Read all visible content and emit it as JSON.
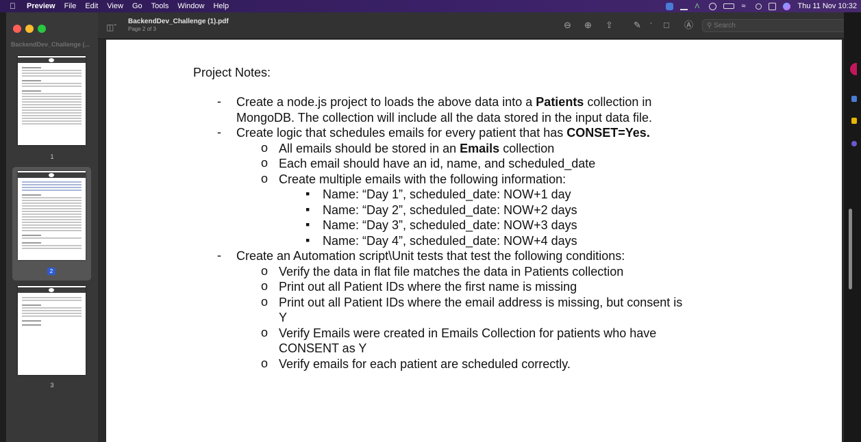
{
  "menubar": {
    "apple": "",
    "app_name": "Preview",
    "menus": [
      "File",
      "Edit",
      "View",
      "Go",
      "Tools",
      "Window",
      "Help"
    ],
    "clock": "Thu 11 Nov  10:32"
  },
  "sidebar": {
    "title": "BackendDev_Challenge (...",
    "pages": [
      {
        "label": "1",
        "selected": false
      },
      {
        "label": "2",
        "selected": true
      },
      {
        "label": "3",
        "selected": false
      }
    ]
  },
  "toolbar": {
    "doc_title": "BackendDev_Challenge (1).pdf",
    "page_indicator": "Page 2 of 3",
    "search_placeholder": "Search",
    "icons": [
      "sidebar-toggle-icon",
      "zoom-out-icon",
      "zoom-in-icon",
      "share-icon",
      "markup-pen-icon",
      "rotate-icon",
      "annotate-icon",
      "search-icon"
    ]
  },
  "document": {
    "heading": "Project Notes:",
    "bullets": [
      {
        "lines": [
          [
            "Create a node.js project to loads the above data into a ",
            {
              "b": "Patients"
            },
            " collection in"
          ],
          [
            "MongoDB. The collection will include all the data stored in the input data file."
          ]
        ]
      },
      {
        "lines": [
          [
            "Create logic that schedules emails for every patient that has ",
            {
              "b": "CONSET=Yes."
            }
          ]
        ],
        "sub": [
          {
            "text": [
              "All emails should be stored in an ",
              {
                "b": "Emails"
              },
              " collection"
            ]
          },
          {
            "text": [
              "Each email should have an id, name, and scheduled_date"
            ]
          },
          {
            "text": [
              "Create multiple emails with the following information:"
            ],
            "sub": [
              "Name: “Day 1”, scheduled_date: NOW+1 day",
              "Name: “Day 2”, scheduled_date: NOW+2 days",
              "Name: “Day 3”, scheduled_date: NOW+3 days",
              "Name: “Day 4”, scheduled_date: NOW+4 days"
            ]
          }
        ]
      },
      {
        "lines": [
          [
            "Create an Automation script\\Unit tests that test the following conditions:"
          ]
        ],
        "sub": [
          {
            "text": [
              "Verify the data in flat file matches the data in Patients collection"
            ]
          },
          {
            "text": [
              "Print out all Patient IDs where the first name is missing"
            ]
          },
          {
            "text": [
              "Print out all Patient IDs where the email address is missing, but consent is"
            ],
            "cont": "Y"
          },
          {
            "text": [
              "Verify Emails were created in Emails Collection for patients who have"
            ],
            "cont": "CONSENT as Y"
          },
          {
            "text": [
              "Verify emails for each patient are scheduled correctly."
            ]
          }
        ]
      }
    ],
    "markers": {
      "dash": "-",
      "circle": "o",
      "square": "▪"
    }
  },
  "colors": {
    "menubar": "#3b2168",
    "sidebar": "#383838",
    "toolbar": "#323232",
    "selected_page": "#2f5bd0"
  }
}
